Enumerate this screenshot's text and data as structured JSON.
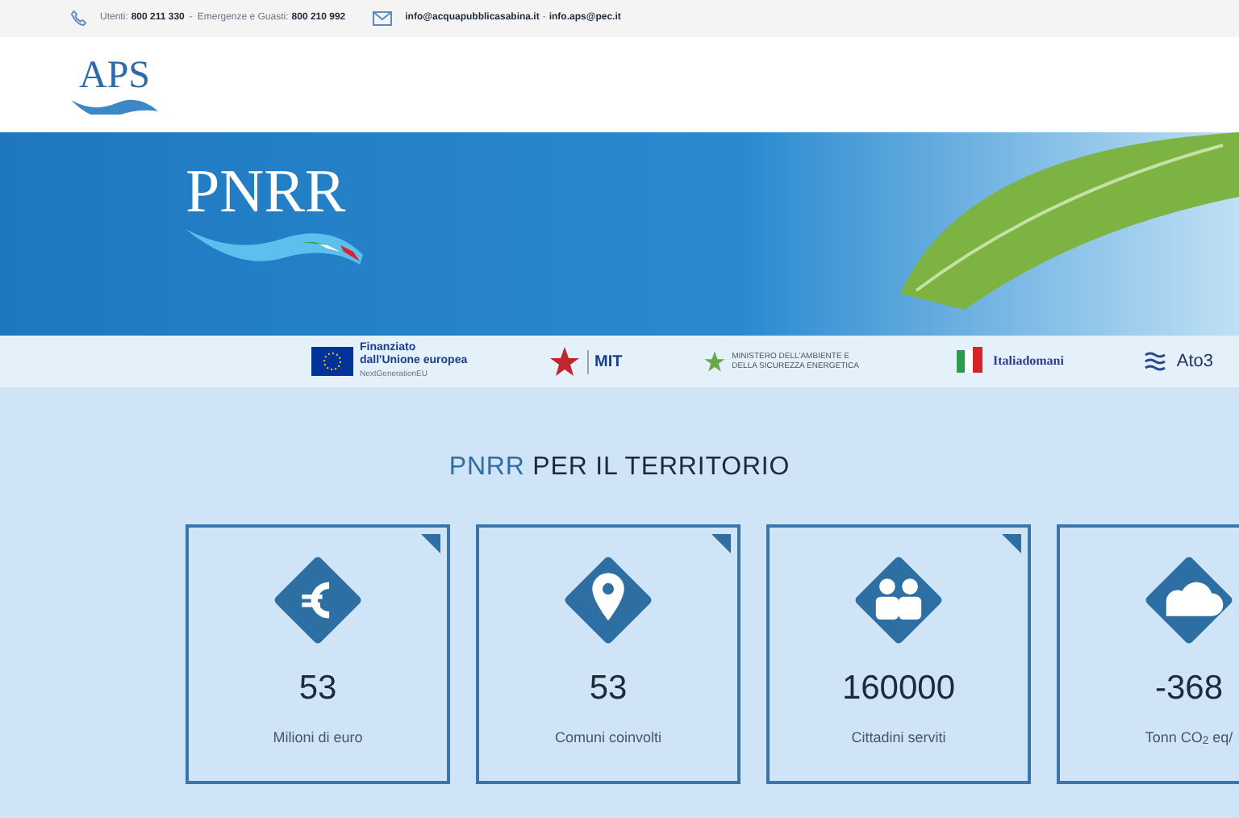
{
  "top_bar": {
    "phone_label_1": "Utenti:",
    "phone_1": "800 211 330",
    "separator": "-",
    "phone_label_2": "Emergenze e Guasti:",
    "phone_2": "800 210 992",
    "email_1": "info@acquapubblicasabina.it",
    "email_separator": "-",
    "email_2": "info.aps@pec.it"
  },
  "header": {
    "logo": "APS"
  },
  "hero": {
    "logo": "PNRR"
  },
  "partners": [
    {
      "kind": "eu",
      "title": "Finanziato",
      "line": "dall'Unione europea",
      "sub": "NextGenerationEU"
    },
    {
      "kind": "mit",
      "title": "MIT"
    },
    {
      "kind": "mase",
      "title": "MINISTERO DELL'AMBIENTE E DELLA SICUREZZA ENERGETICA"
    },
    {
      "kind": "italia",
      "title": "Italiadomani"
    },
    {
      "kind": "ato",
      "title": "Ato3"
    }
  ],
  "section": {
    "title_highlight": "PNRR",
    "title_rest": "PER IL TERRITORIO"
  },
  "stats": [
    {
      "kind": "euro",
      "value": "53",
      "label": "Milioni di euro"
    },
    {
      "kind": "pin",
      "value": "53",
      "label": "Comuni coinvolti"
    },
    {
      "kind": "people",
      "value": "160000",
      "label": "Cittadini serviti"
    },
    {
      "kind": "cloud",
      "value": "-368",
      "label": "Tonn CO$_{2}$ eq/"
    }
  ]
}
